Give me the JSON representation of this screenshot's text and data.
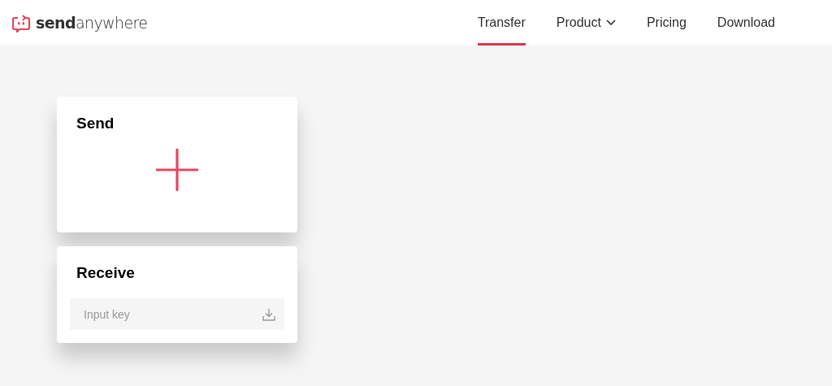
{
  "header": {
    "logo": "**send**anywhere",
    "nav": [
      {
        "label": "Transfer",
        "selected": true,
        "has_menu": false
      },
      {
        "label": "Product",
        "selected": false,
        "has_menu": true
      },
      {
        "label": "Pricing",
        "selected": false,
        "has_menu": false
      },
      {
        "label": "Download",
        "selected": false,
        "has_menu": false
      }
    ]
  },
  "send_card": {
    "title": "Send"
  },
  "receive_card": {
    "title": "Receive",
    "key_field": {
      "placeholder": "Input key"
    }
  }
}
